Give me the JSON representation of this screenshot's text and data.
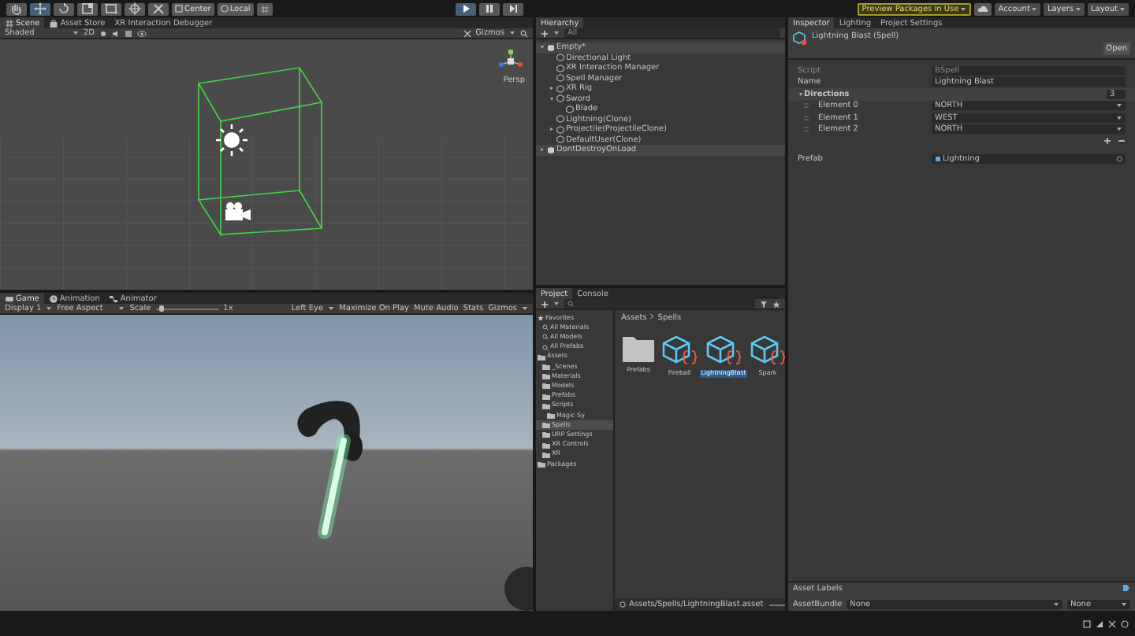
{
  "toolbar": {
    "tools": [
      {
        "selected": false
      },
      {
        "selected": true
      },
      {
        "selected": false
      },
      {
        "selected": false
      },
      {
        "selected": false
      },
      {
        "selected": false
      },
      {
        "selected": false
      }
    ],
    "pivot": "Center",
    "space": "Local",
    "playback": [
      {
        "kind": "play",
        "on": true
      },
      {
        "kind": "pause",
        "on": false
      },
      {
        "kind": "step",
        "on": false
      }
    ],
    "packages": "Preview Packages in Use",
    "account": "Account",
    "layers": "Layers",
    "layout": "Layout"
  },
  "scene_panel": {
    "tabs": [
      {
        "label": "Scene",
        "selected": true
      },
      {
        "label": "Asset Store",
        "selected": false
      },
      {
        "label": "XR Interaction Debugger",
        "selected": false
      }
    ],
    "toolbar": {
      "shading": "Shaded",
      "mode": "2D",
      "gizmos": "Gizmos"
    },
    "view_label": "Persp"
  },
  "game_panel": {
    "tabs": [
      {
        "label": "Game",
        "selected": true
      },
      {
        "label": "Animation",
        "selected": false
      },
      {
        "label": "Animator",
        "selected": false
      }
    ],
    "toolbar": {
      "display": "Display 1",
      "aspect": "Free Aspect",
      "scale_label": "Scale",
      "scale_slider": {
        "level": 0.05
      },
      "scale_value": "1x",
      "eye": "Left Eye",
      "toggles": [
        "Maximize On Play",
        "Mute Audio",
        "Stats",
        "Gizmos"
      ]
    }
  },
  "hierarchy": {
    "tab": "Hierarchy",
    "search_placeholder": "All",
    "items": [
      {
        "label": "Empty*",
        "kind": "scene",
        "expanded": true,
        "children": [
          {
            "label": "Directional Light",
            "kind": "object"
          },
          {
            "label": "XR Interaction Manager",
            "kind": "object"
          },
          {
            "label": "Spell Manager",
            "kind": "object"
          },
          {
            "label": "XR Rig",
            "kind": "object",
            "expanded": false
          },
          {
            "label": "Sword",
            "kind": "object",
            "expanded": true,
            "children": [
              {
                "label": "Blade",
                "kind": "object"
              }
            ]
          },
          {
            "label": "Lightning(Clone)",
            "kind": "object"
          },
          {
            "label": "Projectile(ProjectileClone)",
            "kind": "object",
            "expanded": false
          },
          {
            "label": "DefaultUser(Clone)",
            "kind": "object"
          }
        ]
      },
      {
        "label": "DontDestroyOnLoad",
        "kind": "scene",
        "expanded": false
      }
    ]
  },
  "project": {
    "tabs": [
      {
        "label": "Project",
        "selected": true
      },
      {
        "label": "Console",
        "selected": false
      }
    ],
    "folders": [
      {
        "label": "Favorites",
        "kind": "header",
        "selected": false,
        "children": [
          {
            "label": "All Materials",
            "kind": "search",
            "selected": false
          },
          {
            "label": "All Models",
            "kind": "search",
            "selected": false
          },
          {
            "label": "All Prefabs",
            "kind": "search",
            "selected": false
          }
        ]
      },
      {
        "label": "Assets",
        "kind": "folder",
        "selected": false,
        "children": [
          {
            "label": "_Scenes",
            "kind": "folder",
            "selected": false
          },
          {
            "label": "Materials",
            "kind": "folder",
            "selected": false
          },
          {
            "label": "Models",
            "kind": "folder",
            "selected": false
          },
          {
            "label": "Prefabs",
            "kind": "folder",
            "selected": false
          },
          {
            "label": "Scripts",
            "kind": "folder",
            "selected": false,
            "children": [
              {
                "label": "Magic Sy",
                "kind": "folder",
                "selected": false
              }
            ]
          },
          {
            "label": "Spells",
            "kind": "folder",
            "selected": true
          },
          {
            "label": "URP Settings",
            "kind": "folder",
            "selected": false
          },
          {
            "label": "XR Controls",
            "kind": "folder",
            "selected": false
          },
          {
            "label": "XR",
            "kind": "folder",
            "selected": false
          }
        ]
      },
      {
        "label": "Packages",
        "kind": "folder",
        "selected": false
      }
    ],
    "breadcrumb": [
      "Assets",
      "Spells"
    ],
    "assets": [
      {
        "label": "Prefabs",
        "kind": "folder",
        "selected": false
      },
      {
        "label": "Fireball",
        "kind": "script",
        "selected": false
      },
      {
        "label": "LightningBlast",
        "kind": "script",
        "selected": true
      },
      {
        "label": "Spark",
        "kind": "script",
        "selected": false
      }
    ],
    "path": "Assets/Spells/LightningBlast.asset",
    "zoom_slider": {
      "level": 0.8
    }
  },
  "inspector": {
    "tabs": [
      {
        "label": "Inspector",
        "selected": true
      },
      {
        "label": "Lighting",
        "selected": false
      },
      {
        "label": "Project Settings",
        "selected": false
      }
    ],
    "title": "Lightning Blast (Spell)",
    "open_button": "Open",
    "fields": [
      {
        "label": "Script",
        "value": "BSpell",
        "disabled": true
      },
      {
        "label": "Name",
        "value": "Lightning Blast",
        "disabled": false
      }
    ],
    "list": {
      "label": "Directions",
      "size": "3",
      "elements": [
        {
          "label": "Element 0",
          "value": "NORTH"
        },
        {
          "label": "Element 1",
          "value": "WEST"
        },
        {
          "label": "Element 2",
          "value": "NORTH"
        }
      ]
    },
    "prefab": {
      "label": "Prefab",
      "value": "Lightning"
    },
    "asset_labels": "Asset Labels",
    "bundle": {
      "label": "AssetBundle",
      "value": "None",
      "variant": "None"
    }
  }
}
